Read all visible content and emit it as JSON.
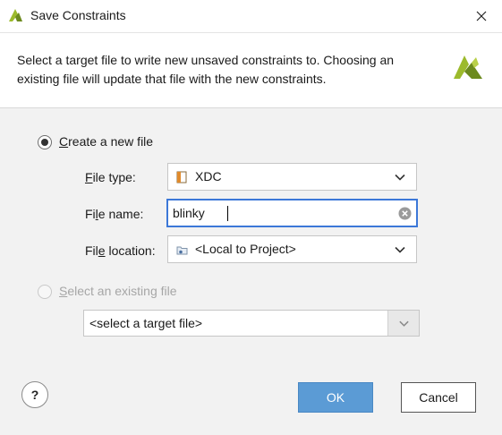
{
  "window": {
    "title": "Save Constraints"
  },
  "header": {
    "description": "Select a target file to write new unsaved constraints to. Choosing an existing file will update that file with the new constraints."
  },
  "create_new": {
    "label_mnemonic": "C",
    "label_rest": "reate a new file",
    "selected": true,
    "file_type": {
      "label_mnemonic": "F",
      "label_rest": "ile type:",
      "value": "XDC"
    },
    "file_name": {
      "label_pre": "Fi",
      "label_mnemonic": "l",
      "label_rest": "e name:",
      "value": "blinky"
    },
    "file_location": {
      "label_pre": "Fil",
      "label_mnemonic": "e",
      "label_rest": " location:",
      "value": "<Local to Project>"
    }
  },
  "existing": {
    "label_mnemonic": "S",
    "label_rest": "elect an existing file",
    "selected": false,
    "placeholder": "<select a target file>"
  },
  "buttons": {
    "help": "?",
    "ok": "OK",
    "cancel": "Cancel"
  },
  "colors": {
    "accent": "#3c78d8",
    "ok_bg": "#5b9bd5",
    "logo_green": "#9cba2c",
    "logo_dark": "#6c8a1e"
  },
  "icons": {
    "title_logo": "vivado-logo-icon",
    "close": "close-icon",
    "header_logo": "vivado-logo-icon",
    "file_type": "xdc-file-icon",
    "location": "folder-location-icon",
    "clear": "clear-icon",
    "chevron": "chevron-down-icon"
  }
}
